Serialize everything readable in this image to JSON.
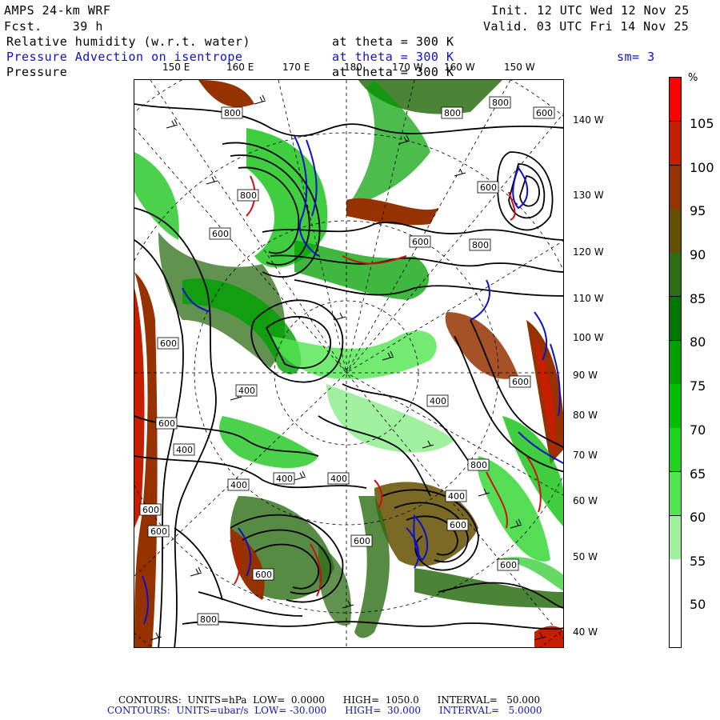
{
  "header": {
    "model": "AMPS 24-km WRF",
    "fcst": "Fcst.    39 h",
    "init": "Init. 12 UTC Wed 12 Nov 25",
    "valid": "Valid. 03 UTC Fri 14 Nov 25",
    "line1_field": "Relative humidity (w.r.t. water)",
    "line1_level": "at theta = 300 K",
    "line2_field": "Pressure Advection on isentrope",
    "line2_level": "at theta = 300 K",
    "line2_smooth": "sm= 3",
    "line3_field": "Pressure",
    "line3_level": "at theta = 300 K"
  },
  "lon_labels": [
    "150 E",
    "160 E",
    "170 E",
    "180",
    "170 W",
    "160 W",
    "150 W"
  ],
  "lat_labels": [
    "140 W",
    "130 W",
    "120 W",
    "110 W",
    "100 W",
    "90 W",
    "80 W",
    "70 W",
    "60 W",
    "50 W",
    "40 W"
  ],
  "colorbar": {
    "unit": "%",
    "labels": [
      "105",
      "100",
      "95",
      "90",
      "85",
      "80",
      "75",
      "70",
      "65",
      "60",
      "55",
      "50"
    ],
    "colors": [
      "#ff0000",
      "#c81e00",
      "#963200",
      "#645000",
      "#2d6e14",
      "#007800",
      "#00a000",
      "#00be00",
      "#1ed21e",
      "#50e650",
      "#a0f0a0",
      "#ffffff",
      "#ffffff"
    ]
  },
  "contour_labels": [
    "800",
    "800",
    "800",
    "600",
    "800",
    "600",
    "600",
    "600",
    "800",
    "600",
    "400",
    "600",
    "600",
    "400",
    "400",
    "400",
    "400",
    "400",
    "600",
    "800",
    "400",
    "600",
    "600",
    "600",
    "400",
    "600",
    "600",
    "800"
  ],
  "footer": {
    "line1": "CONTOURS:  UNITS=hPa  LOW=  0.0000      HIGH=  1050.0      INTERVAL=   50.000",
    "line2": "CONTOURS:  UNITS=ubar/s  LOW= -30.000      HIGH=  30.000      INTERVAL=   5.0000"
  }
}
